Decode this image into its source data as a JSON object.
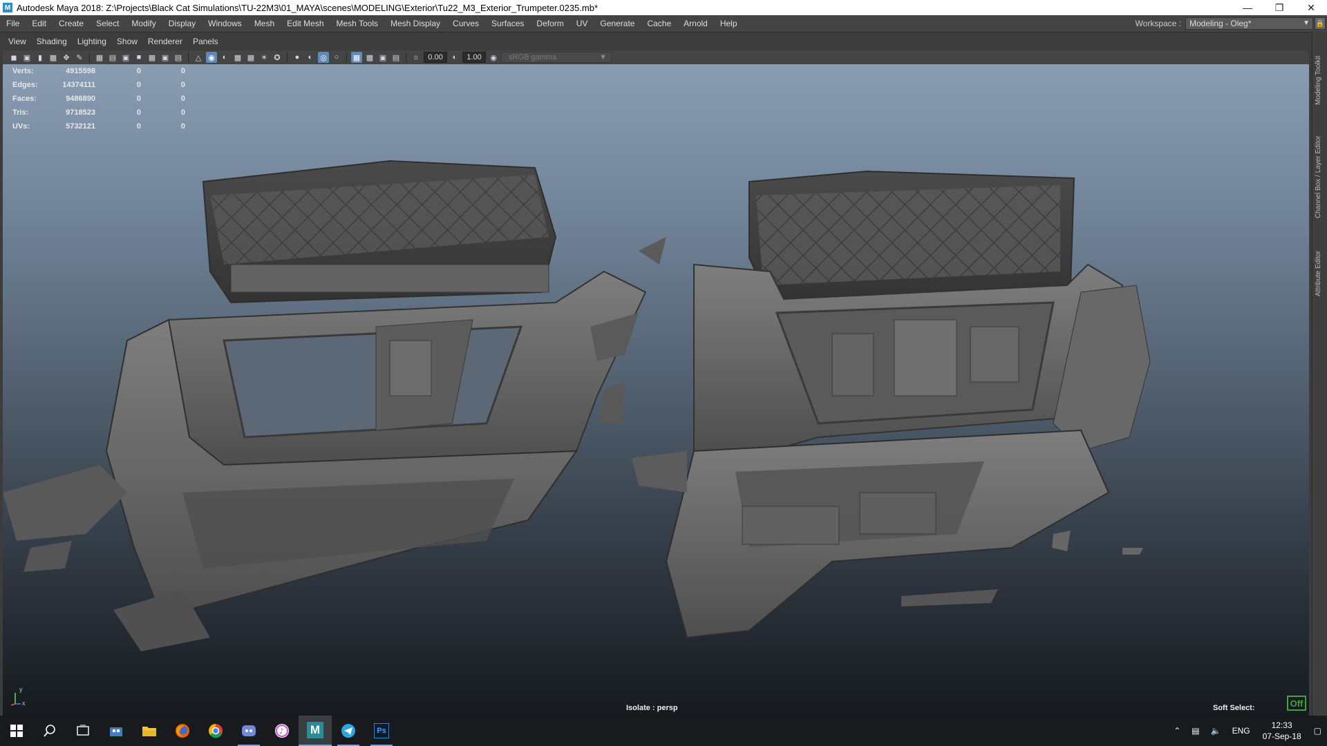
{
  "titlebar": {
    "title": "Autodesk Maya 2018: Z:\\Projects\\Black Cat Simulations\\TU-22M3\\01_MAYA\\scenes\\MODELING\\Exterior\\Tu22_M3_Exterior_Trumpeter.0235.mb*",
    "app_icon": "M"
  },
  "menubar": {
    "items": [
      "File",
      "Edit",
      "Create",
      "Select",
      "Modify",
      "Display",
      "Windows",
      "Mesh",
      "Edit Mesh",
      "Mesh Tools",
      "Mesh Display",
      "Curves",
      "Surfaces",
      "Deform",
      "UV",
      "Generate",
      "Cache",
      "Arnold",
      "Help"
    ],
    "workspace_label": "Workspace :",
    "workspace_value": "Modeling - Oleg*"
  },
  "panel": {
    "menu": [
      "View",
      "Shading",
      "Lighting",
      "Show",
      "Renderer",
      "Panels"
    ],
    "exposure": "0.00",
    "gamma": "1.00",
    "color_space": "sRGB gamma"
  },
  "hud": {
    "rows": [
      {
        "label": "Verts:",
        "v1": "4915598",
        "v2": "0",
        "v3": "0"
      },
      {
        "label": "Edges:",
        "v1": "14374111",
        "v2": "0",
        "v3": "0"
      },
      {
        "label": "Faces:",
        "v1": "9486890",
        "v2": "0",
        "v3": "0"
      },
      {
        "label": "Tris:",
        "v1": "9718523",
        "v2": "0",
        "v3": "0"
      },
      {
        "label": "UVs:",
        "v1": "5732121",
        "v2": "0",
        "v3": "0"
      }
    ],
    "isolate": "Isolate : persp",
    "soft_select": "Soft Select:",
    "soft_select_state": "Off",
    "axis_y": "y",
    "axis_x": "x"
  },
  "dock": {
    "tabs": [
      "Modeling Toolkit",
      "Channel Box / Layer Editor",
      "Attribute Editor"
    ]
  },
  "taskbar": {
    "apps": [
      "start-icon",
      "search-icon",
      "task-view-icon",
      "store-icon",
      "file-explorer-icon",
      "firefox-icon",
      "chrome-icon",
      "discord-icon",
      "itunes-icon",
      "maya-icon",
      "telegram-icon",
      "photoshop-icon"
    ],
    "maya_label": "M",
    "ps_label": "Ps",
    "language": "ENG",
    "time": "12:33",
    "date": "07-Sep-18"
  },
  "colors": {
    "accent": "#5d8ab6",
    "soft_select_badge": "#3ea63e",
    "viewport_top": "#899cb2",
    "viewport_bottom": "#161a1f"
  }
}
